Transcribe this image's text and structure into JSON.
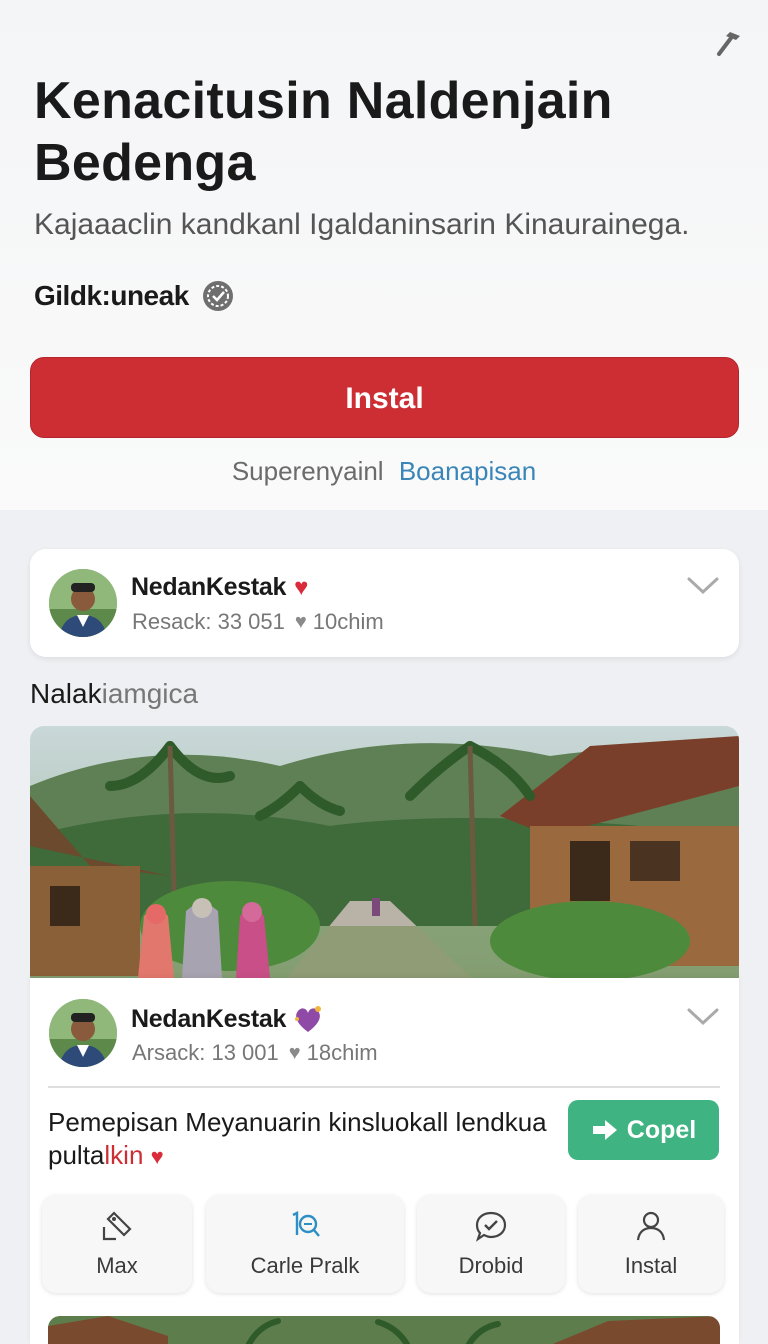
{
  "app": {
    "title": "Kenacitusin Naldenjain Bedenga",
    "subtitle": "Kajaaaclin kandkanl Igaldaninsarin Kinaurainega.",
    "developer": "Gildk:uneak",
    "install_label": "Instal",
    "support_text": "Superenyainl",
    "support_link": "Boanapisan"
  },
  "review": {
    "name": "NedanKestak",
    "meta_left": "Resack: 33 051",
    "meta_right": "10chim"
  },
  "section": {
    "label_strong": "Nalak",
    "label_light": "iamgica"
  },
  "post": {
    "name": "NedanKestak",
    "meta_left": "Arsack: 13 001",
    "meta_right": "18chim",
    "text_main": "Pemepisan Meyanuarin kinsluokall lendkua pulta",
    "text_red": "lkin",
    "compel_label": "Copel",
    "actions": [
      {
        "label": "Max",
        "icon": "tag-edit-icon"
      },
      {
        "label": "Carle Pralk",
        "icon": "search-plus-icon"
      },
      {
        "label": "Drobid",
        "icon": "chat-check-icon"
      },
      {
        "label": "Instal",
        "icon": "person-icon"
      }
    ]
  },
  "colors": {
    "install_red": "#cc2e34",
    "compel_green": "#3fb381",
    "link_blue": "#3a86b8"
  }
}
